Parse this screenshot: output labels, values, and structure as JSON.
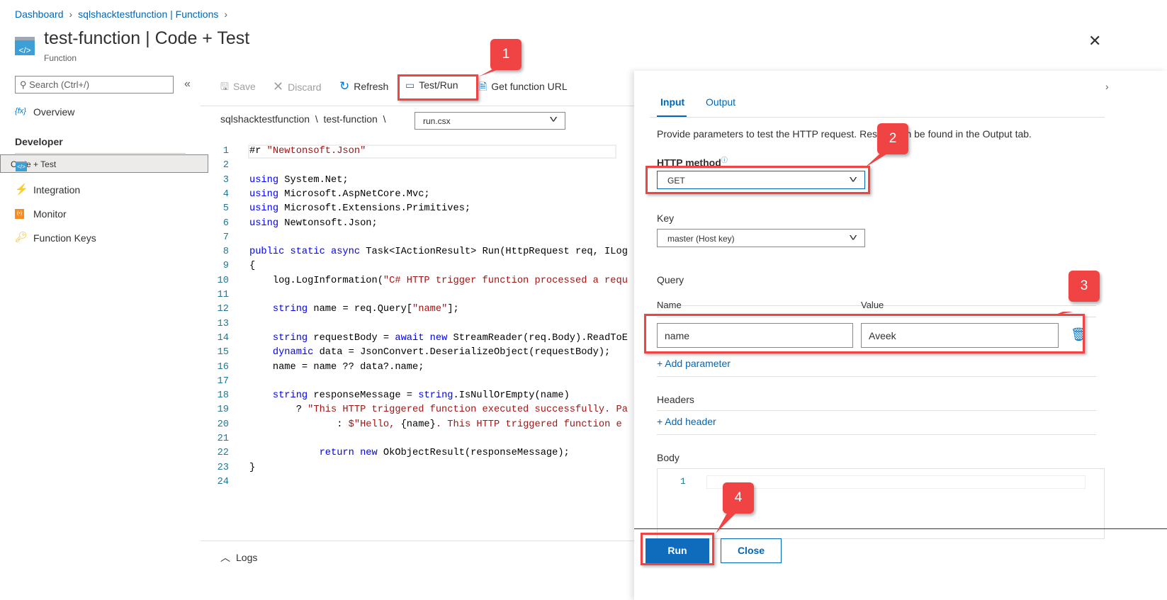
{
  "breadcrumb": [
    "Dashboard",
    "sqlshacktestfunction | Functions"
  ],
  "header": {
    "title_main": "test-function",
    "title_sep": " | ",
    "title_rest": "Code + Test",
    "subtitle": "Function",
    "close": "✕"
  },
  "sidebar": {
    "search_placeholder": "Search (Ctrl+/)",
    "collapse": "«",
    "overview": "Overview",
    "section": "Developer",
    "items": [
      {
        "label": "Code + Test",
        "selected": true
      },
      {
        "label": "Integration"
      },
      {
        "label": "Monitor"
      },
      {
        "label": "Function Keys"
      }
    ]
  },
  "toolbar": {
    "save": "Save",
    "discard": "Discard",
    "refresh": "Refresh",
    "testrun": "Test/Run",
    "geturl": "Get function URL"
  },
  "path": {
    "app": "sqlshacktestfunction",
    "sep": "  \\  ",
    "func": "test-function",
    "file": "run.csx"
  },
  "code": [
    [
      [
        "#r ",
        ""
      ],
      [
        "\"Newtonsoft.Json\"",
        "str"
      ]
    ],
    [],
    [
      [
        "using",
        "kw"
      ],
      [
        " System.Net;",
        ""
      ]
    ],
    [
      [
        "using",
        "kw"
      ],
      [
        " Microsoft.AspNetCore.Mvc;",
        ""
      ]
    ],
    [
      [
        "using",
        "kw"
      ],
      [
        " Microsoft.Extensions.Primitives;",
        ""
      ]
    ],
    [
      [
        "using",
        "kw"
      ],
      [
        " Newtonsoft.Json;",
        ""
      ]
    ],
    [],
    [
      [
        "public static async",
        "kw"
      ],
      [
        " Task<IActionResult> Run(HttpRequest req, ILog",
        ""
      ]
    ],
    [
      [
        "{",
        ""
      ]
    ],
    [
      [
        "    log.LogInformation(",
        ""
      ],
      [
        "\"C# HTTP trigger function processed a requ",
        "str"
      ]
    ],
    [],
    [
      [
        "    ",
        ""
      ],
      [
        "string",
        "kw"
      ],
      [
        " name = req.Query[",
        ""
      ],
      [
        "\"name\"",
        "str"
      ],
      [
        "];",
        ""
      ]
    ],
    [],
    [
      [
        "    ",
        ""
      ],
      [
        "string",
        "kw"
      ],
      [
        " requestBody = ",
        ""
      ],
      [
        "await new",
        "kw"
      ],
      [
        " StreamReader(req.Body).ReadToE",
        ""
      ]
    ],
    [
      [
        "    ",
        ""
      ],
      [
        "dynamic",
        "kw"
      ],
      [
        " data = JsonConvert.DeserializeObject(requestBody);",
        ""
      ]
    ],
    [
      [
        "    name = name ?? data?.name;",
        ""
      ]
    ],
    [],
    [
      [
        "    ",
        ""
      ],
      [
        "string",
        "kw"
      ],
      [
        " responseMessage = ",
        ""
      ],
      [
        "string",
        "kw"
      ],
      [
        ".IsNullOrEmpty(name)",
        ""
      ]
    ],
    [
      [
        "        ? ",
        ""
      ],
      [
        "\"This HTTP triggered function executed successfully. Pa",
        "str"
      ]
    ],
    [
      [
        "               : ",
        ""
      ],
      [
        "$\"Hello, ",
        "str"
      ],
      [
        "{name}",
        ""
      ],
      [
        ". This HTTP triggered function e",
        "str"
      ]
    ],
    [],
    [
      [
        "            ",
        ""
      ],
      [
        "return new",
        "kw"
      ],
      [
        " OkObjectResult(responseMessage);",
        ""
      ]
    ],
    [
      [
        "}",
        ""
      ]
    ],
    []
  ],
  "panel": {
    "tabs": [
      "Input",
      "Output"
    ],
    "description": "Provide parameters to test the HTTP request. Results can be found in the Output tab.",
    "http_method_label": "HTTP method",
    "http_method": "GET",
    "key_label": "Key",
    "key": "master (Host key)",
    "query_label": "Query",
    "col_name": "Name",
    "col_value": "Value",
    "param_name": "name",
    "param_value": "Aveek",
    "add_parameter": "+ Add parameter",
    "headers_label": "Headers",
    "add_header": "+ Add header",
    "body_label": "Body",
    "body_line": "1",
    "run": "Run",
    "close": "Close"
  },
  "logs": "Logs",
  "callouts": [
    "1",
    "2",
    "3",
    "4"
  ]
}
